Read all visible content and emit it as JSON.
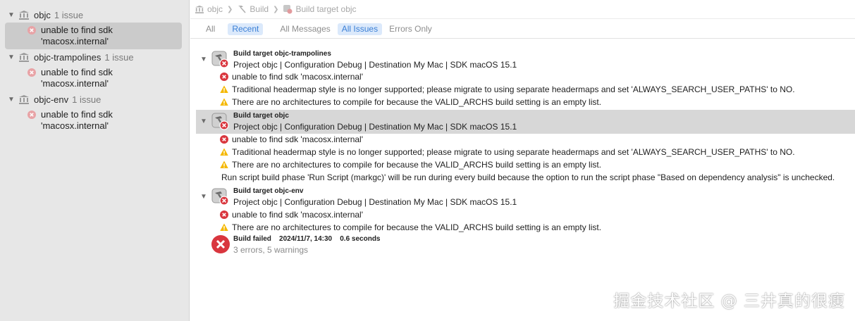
{
  "navigator": {
    "groups": [
      {
        "name": "objc",
        "count": "1 issue",
        "issue": [
          "unable to find sdk",
          "'macosx.internal'"
        ]
      },
      {
        "name": "objc-trampolines",
        "count": "1 issue",
        "issue": [
          "unable to find sdk",
          "'macosx.internal'"
        ]
      },
      {
        "name": "objc-env",
        "count": "1 issue",
        "issue": [
          "unable to find sdk",
          "'macosx.internal'"
        ]
      }
    ]
  },
  "jumpbar": {
    "crumbs": [
      "objc",
      "Build",
      "Build target objc"
    ]
  },
  "filters": {
    "all": "All",
    "recent": "Recent",
    "all_messages": "All Messages",
    "all_issues": "All Issues",
    "errors_only": "Errors Only"
  },
  "log": {
    "targets": [
      {
        "title": "Build target objc-trampolines",
        "subtitle": "Project objc | Configuration Debug | Destination My Mac | SDK macOS 15.1",
        "messages": [
          {
            "type": "error",
            "text": "unable to find sdk 'macosx.internal'"
          },
          {
            "type": "warning",
            "text": "Traditional headermap style is no longer supported; please migrate to using separate headermaps and set 'ALWAYS_SEARCH_USER_PATHS' to NO."
          },
          {
            "type": "warning",
            "text": "There are no architectures to compile for because the VALID_ARCHS build setting is an empty list."
          }
        ]
      },
      {
        "title": "Build target objc",
        "subtitle": "Project objc | Configuration Debug | Destination My Mac | SDK macOS 15.1",
        "messages": [
          {
            "type": "error",
            "text": "unable to find sdk 'macosx.internal'"
          },
          {
            "type": "warning",
            "text": "Traditional headermap style is no longer supported; please migrate to using separate headermaps and set 'ALWAYS_SEARCH_USER_PATHS' to NO."
          },
          {
            "type": "warning",
            "text": "There are no architectures to compile for because the VALID_ARCHS build setting is an empty list."
          },
          {
            "type": "note",
            "text": "Run script build phase 'Run Script (markgc)' will be run during every build because the option to run the script phase \"Based on dependency analysis\" is unchecked."
          }
        ]
      },
      {
        "title": "Build target objc-env",
        "subtitle": "Project objc | Configuration Debug | Destination My Mac | SDK macOS 15.1",
        "messages": [
          {
            "type": "error",
            "text": "unable to find sdk 'macosx.internal'"
          },
          {
            "type": "warning",
            "text": "There are no architectures to compile for because the VALID_ARCHS build setting is an empty list."
          }
        ]
      }
    ],
    "result": {
      "title": "Build failed",
      "datetime": "2024/11/7, 14:30",
      "duration": "0.6 seconds",
      "summary": "3 errors, 5 warnings"
    }
  },
  "watermark": "掘金技术社区 @ 三井真的很瘦",
  "colors": {
    "error": "#d9363e",
    "warning": "#f5b800",
    "selection": "#cbcbcb",
    "accent": "#3a7fd6"
  }
}
